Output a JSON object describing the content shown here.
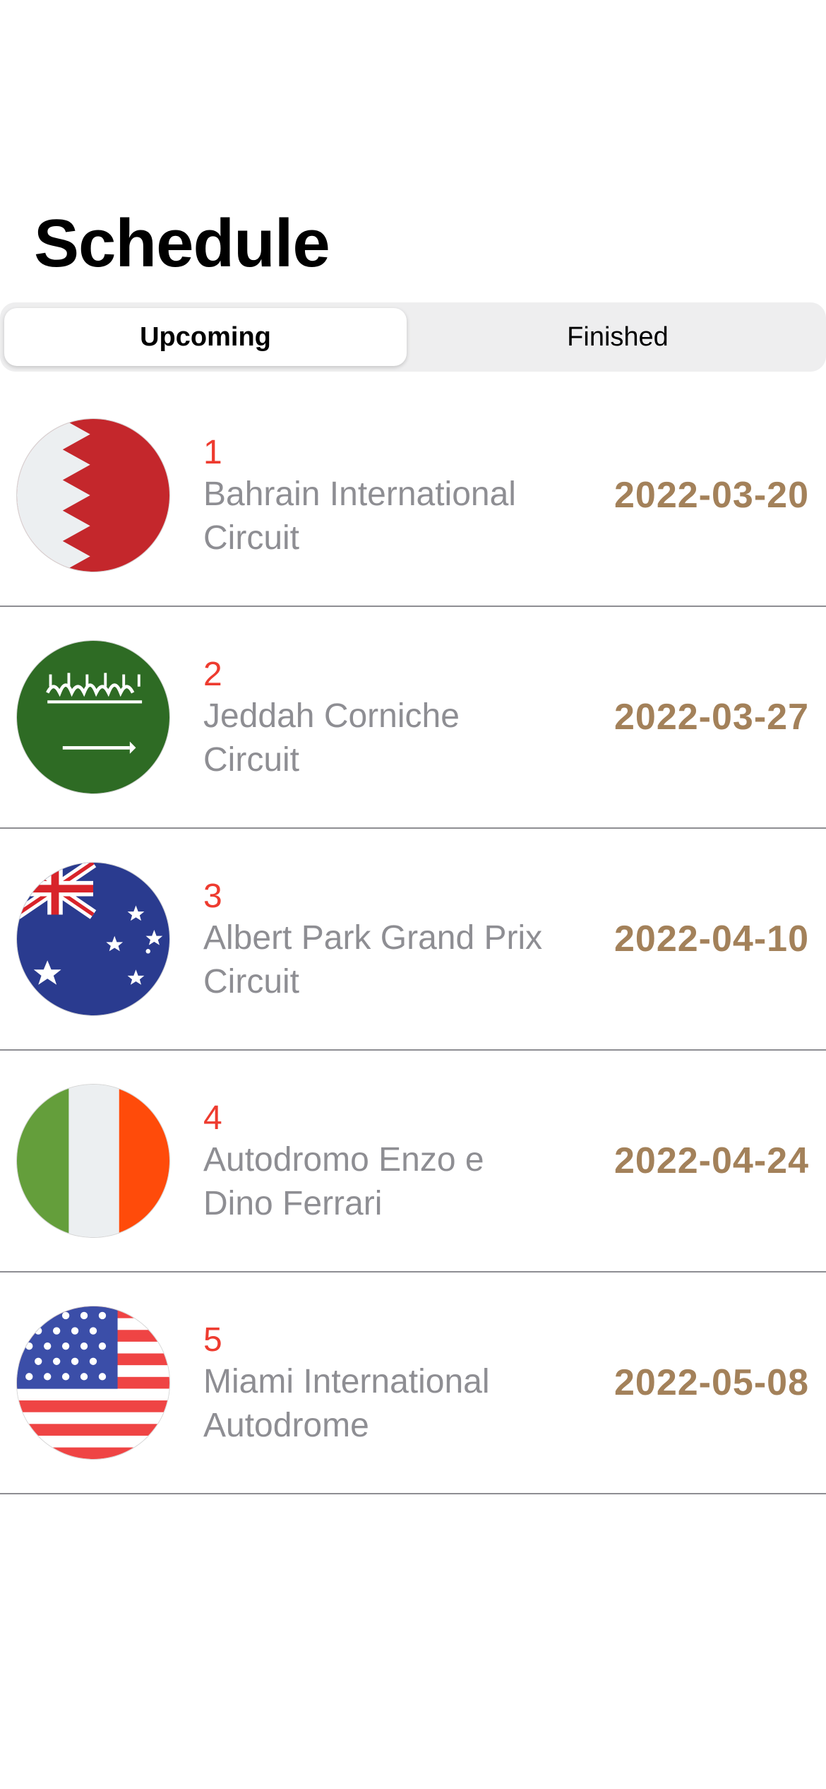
{
  "header": {
    "title": "Schedule"
  },
  "segments": {
    "upcoming": "Upcoming",
    "finished": "Finished",
    "selected": "Upcoming"
  },
  "races": [
    {
      "round": "1",
      "circuit": "Bahrain International Circuit",
      "date": "2022-03-20",
      "flag_icon": "bahrain-flag-icon"
    },
    {
      "round": "2",
      "circuit": "Jeddah Corniche Circuit",
      "date": "2022-03-27",
      "flag_icon": "saudi-arabia-flag-icon"
    },
    {
      "round": "3",
      "circuit": "Albert Park Grand Prix Circuit",
      "date": "2022-04-10",
      "flag_icon": "australia-flag-icon"
    },
    {
      "round": "4",
      "circuit": "Autodromo Enzo e Dino Ferrari",
      "date": "2022-04-24",
      "flag_icon": "italy-flag-icon"
    },
    {
      "round": "5",
      "circuit": "Miami International Autodrome",
      "date": "2022-05-08",
      "flag_icon": "usa-flag-icon"
    }
  ],
  "colors": {
    "round": "#ee3b2f",
    "circuit": "#8e8e93",
    "date": "#a3815a",
    "segment_bg": "#eeeeef",
    "separator": "#8e8e93"
  }
}
